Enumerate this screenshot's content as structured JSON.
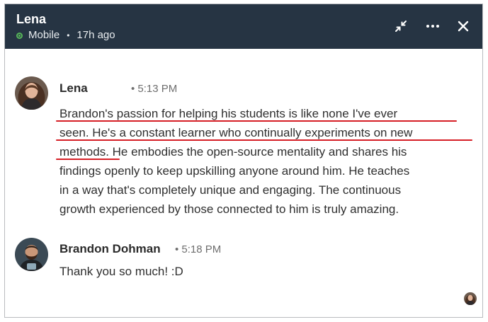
{
  "header": {
    "name": "Lena",
    "status": "Mobile",
    "last_active": "17h ago",
    "icons": [
      "minimize-icon",
      "more-icon",
      "close-icon"
    ],
    "background": "#263443",
    "online_color": "#57b65a"
  },
  "messages": [
    {
      "sender": "Lena",
      "time": "• 5:13 PM",
      "lines": [
        "Brandon's passion for helping his students is like none I've ever",
        "seen. He's a constant learner who continually experiments on new",
        "methods. He embodies the open-source mentality and shares his",
        "findings openly to keep upskilling anyone around him. He teaches",
        "in a way that's completely unique and engaging. The continuous",
        "growth experienced by those connected to him is truly amazing."
      ]
    },
    {
      "sender": "Brandon Dohman",
      "time": "• 5:18 PM",
      "lines": [
        "Thank you so much! :D"
      ]
    }
  ],
  "annotation_color": "#d61f26"
}
